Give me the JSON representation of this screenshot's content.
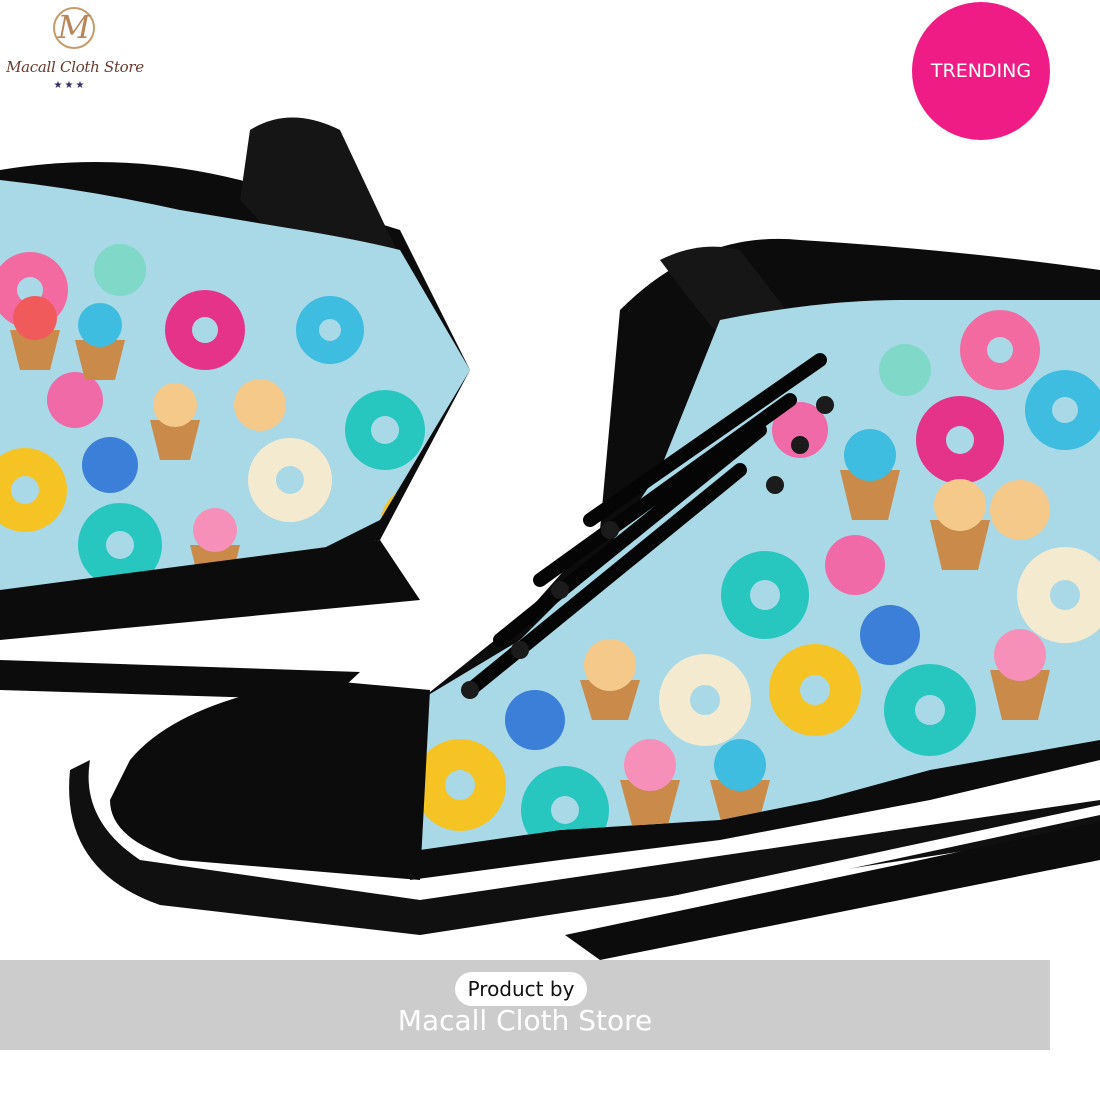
{
  "logo": {
    "monogram": "M",
    "name": "Macall Cloth Store",
    "stars": "★★★"
  },
  "badge": {
    "label": "TRENDING",
    "color": "#ef1c86"
  },
  "caption": {
    "line1": "Product by",
    "line2": "Macall Cloth Store"
  },
  "colors": {
    "canvas": "#a9d9e6",
    "shoe": "#0c0c0c",
    "sole_stripe": "#ffffff"
  },
  "product": {
    "icon": "high-top-sneakers-donut-pattern"
  }
}
